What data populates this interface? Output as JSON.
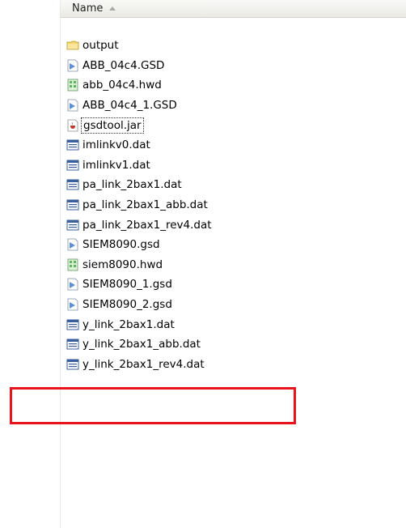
{
  "header": {
    "name_label": "Name"
  },
  "files": [
    {
      "name": "output",
      "icon": "folder-icon"
    },
    {
      "name": "ABB_04c4.GSD",
      "icon": "gsd-file-icon"
    },
    {
      "name": "abb_04c4.hwd",
      "icon": "hwd-file-icon"
    },
    {
      "name": "ABB_04c4_1.GSD",
      "icon": "gsd-file-icon"
    },
    {
      "name": "gsdtool.jar",
      "icon": "jar-file-icon"
    },
    {
      "name": "imlinkv0.dat",
      "icon": "dat-file-icon"
    },
    {
      "name": "imlinkv1.dat",
      "icon": "dat-file-icon"
    },
    {
      "name": "pa_link_2bax1.dat",
      "icon": "dat-file-icon"
    },
    {
      "name": "pa_link_2bax1_abb.dat",
      "icon": "dat-file-icon"
    },
    {
      "name": "pa_link_2bax1_rev4.dat",
      "icon": "dat-file-icon"
    },
    {
      "name": "SIEM8090.gsd",
      "icon": "gsd-file-icon"
    },
    {
      "name": "siem8090.hwd",
      "icon": "hwd-file-icon"
    },
    {
      "name": "SIEM8090_1.gsd",
      "icon": "gsd-file-icon"
    },
    {
      "name": "SIEM8090_2.gsd",
      "icon": "gsd-file-icon"
    },
    {
      "name": "y_link_2bax1.dat",
      "icon": "dat-file-icon"
    },
    {
      "name": "y_link_2bax1_abb.dat",
      "icon": "dat-file-icon"
    },
    {
      "name": "y_link_2bax1_rev4.dat",
      "icon": "dat-file-icon"
    }
  ],
  "colors": {
    "highlight": "#e8131b",
    "folder": "#f2d66b",
    "gsd": "#5b8fd6",
    "hwd": "#5cb85c",
    "dat": "#3a5f9e"
  }
}
